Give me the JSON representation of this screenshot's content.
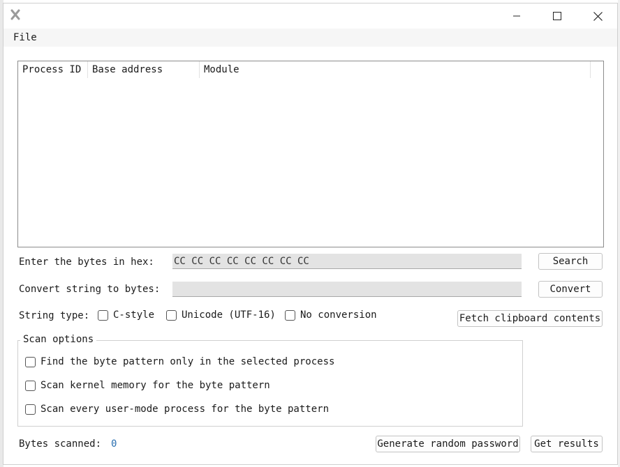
{
  "window": {
    "icon": "app-x-icon",
    "controls": [
      "minimize-icon",
      "maximize-icon",
      "close-icon"
    ]
  },
  "menu": {
    "file": "File"
  },
  "list": {
    "columns": [
      "Process ID",
      "Base address",
      "Module"
    ]
  },
  "hex_input": {
    "label": "Enter the bytes in hex:",
    "value": "CC CC CC CC CC CC CC CC",
    "button": "Search"
  },
  "convert_input": {
    "label": "Convert string to bytes:",
    "value": "",
    "button": "Convert"
  },
  "string_type": {
    "label": "String type:",
    "options": [
      "C-style",
      "Unicode (UTF-16)",
      "No conversion"
    ],
    "clipboard_button": "Fetch clipboard contents"
  },
  "scan_options": {
    "title": "Scan options",
    "options": [
      "Find the byte pattern only in the selected process",
      "Scan kernel memory for the byte pattern",
      "Scan every user-mode process for the byte pattern"
    ]
  },
  "footer": {
    "bytes_label": "Bytes scanned:",
    "bytes_value": "0",
    "password_button": "Generate random password",
    "results_button": "Get results"
  }
}
